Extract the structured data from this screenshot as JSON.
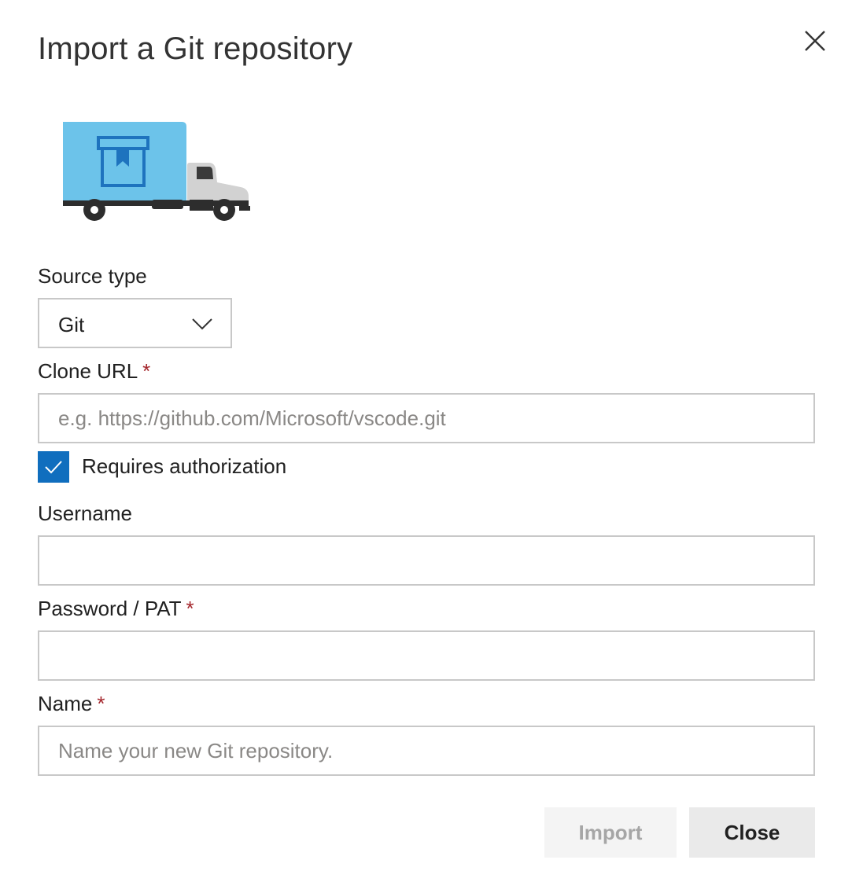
{
  "dialog": {
    "title": "Import a Git repository",
    "close_icon": "close-icon",
    "illustration": "moving-truck-illustration"
  },
  "form": {
    "source_type": {
      "label": "Source type",
      "value": "Git",
      "icon": "chevron-down-icon"
    },
    "clone_url": {
      "label": "Clone URL",
      "required_mark": "*",
      "value": "",
      "placeholder": "e.g. https://github.com/Microsoft/vscode.git"
    },
    "requires_authorization": {
      "label": "Requires authorization",
      "checked": true
    },
    "username": {
      "label": "Username",
      "value": "",
      "placeholder": ""
    },
    "password": {
      "label": "Password / PAT",
      "required_mark": "*",
      "value": "",
      "placeholder": ""
    },
    "name": {
      "label": "Name",
      "required_mark": "*",
      "value": "",
      "placeholder": "Name your new Git repository."
    }
  },
  "buttons": {
    "import_label": "Import",
    "import_disabled": true,
    "close_label": "Close"
  },
  "colors": {
    "accent": "#106ebe",
    "required": "#a4262c",
    "truck_box": "#6cc3ea",
    "truck_icon": "#1e73be"
  }
}
